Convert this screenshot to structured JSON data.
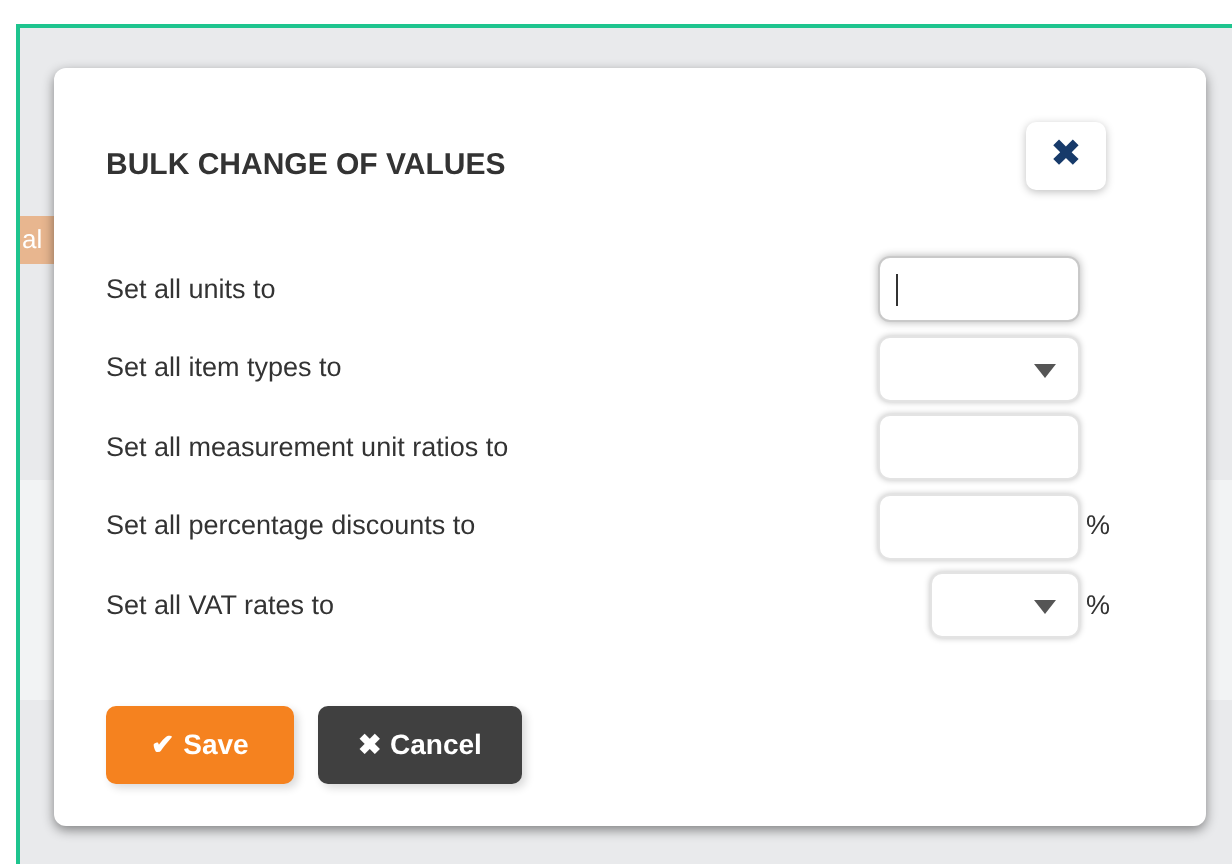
{
  "background": {
    "tag": "al"
  },
  "dialog": {
    "title": "BULK CHANGE OF VALUES",
    "close": "✖",
    "rows": [
      {
        "label": "Set all units to",
        "kind": "text",
        "focused": true
      },
      {
        "label": "Set all item types to",
        "kind": "select",
        "focused": false
      },
      {
        "label": "Set all measurement unit ratios to",
        "kind": "text",
        "focused": false
      },
      {
        "label": "Set all percentage discounts to",
        "kind": "text",
        "focused": false,
        "suffix": "%"
      },
      {
        "label": "Set all VAT rates to",
        "kind": "select-small",
        "focused": false,
        "suffix": "%"
      }
    ],
    "buttons": [
      {
        "kind": "save",
        "icon": "✔",
        "label": "Save"
      },
      {
        "kind": "cancel",
        "icon": "✖",
        "label": "Cancel"
      }
    ]
  }
}
